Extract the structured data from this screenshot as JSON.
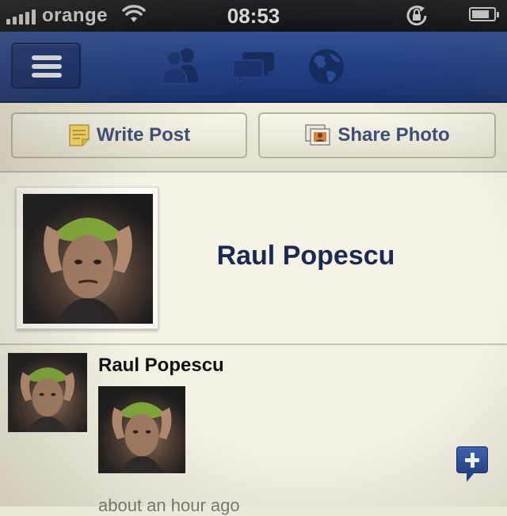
{
  "status_bar": {
    "carrier": "orange",
    "time": "08:53",
    "signal_bars": 5,
    "battery_level": 0.8
  },
  "nav": {
    "icons": [
      "menu-icon",
      "friends-icon",
      "messages-icon",
      "notifications-globe-icon"
    ]
  },
  "actions": {
    "write_post_label": "Write Post",
    "share_photo_label": "Share Photo"
  },
  "profile": {
    "name": "Raul Popescu"
  },
  "feed": {
    "posts": [
      {
        "author": "Raul Popescu",
        "time": "about an hour ago"
      }
    ]
  },
  "colors": {
    "nav_blue": "#21408a",
    "name_navy": "#1b2a52",
    "button_text": "#3e4f74"
  }
}
